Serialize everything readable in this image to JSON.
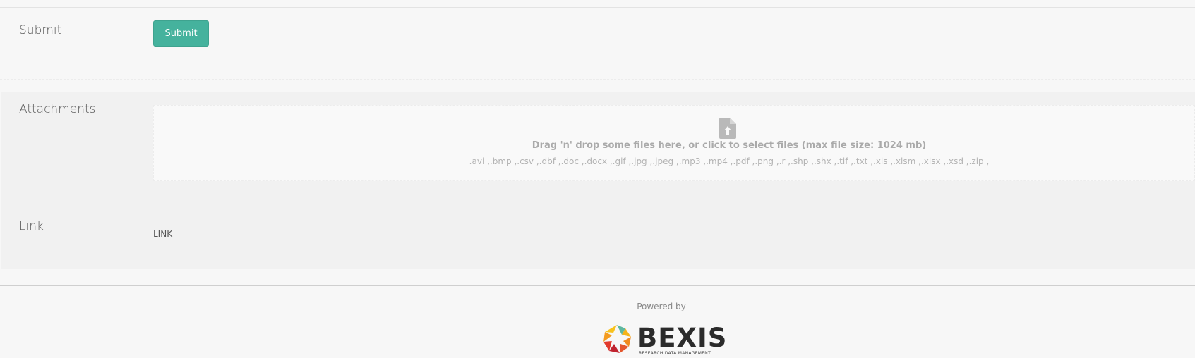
{
  "form": {
    "submit": {
      "label": "Submit",
      "button_label": "Submit"
    },
    "attachments": {
      "label": "Attachments",
      "dropzone_text": "Drag 'n' drop some files here, or click to select files (max file size: 1024 mb)",
      "allowed_types": ".avi ,.bmp ,.csv ,.dbf ,.doc ,.docx ,.gif ,.jpg ,.jpeg ,.mp3 ,.mp4 ,.pdf ,.png ,.r ,.shp ,.shx ,.tif ,.txt ,.xls ,.xlsm ,.xlsx ,.xsd ,.zip ,"
    },
    "link": {
      "label": "Link",
      "value": "LINK"
    }
  },
  "footer": {
    "powered_by": "Powered by",
    "logo_word": "BEXIS",
    "logo_tagline": "RESEARCH DATA MANAGEMENT"
  },
  "colors": {
    "accent": "#45b29d",
    "background": "#f7f7f7",
    "panel": "#f1f1f1"
  },
  "icons": {
    "upload": "file-upload-icon",
    "logo": "bexis-logo-icon"
  }
}
